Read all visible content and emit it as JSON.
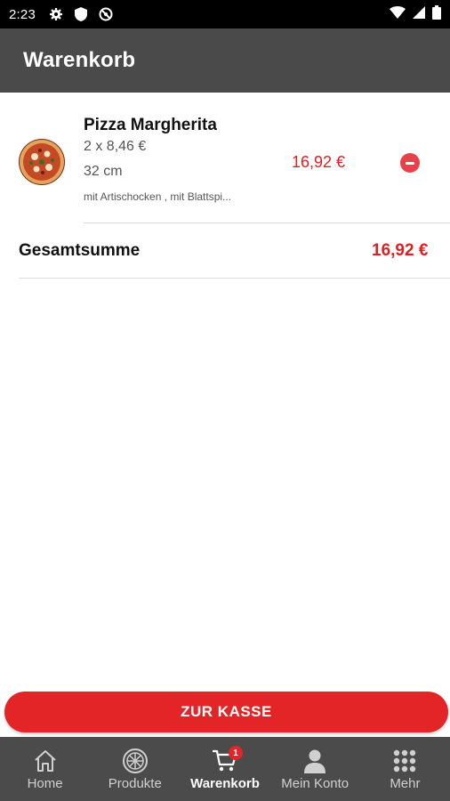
{
  "status_bar": {
    "time": "2:23",
    "icons": [
      "gear-icon",
      "shield-icon",
      "no-disturb-icon",
      "wifi-icon",
      "signal-icon",
      "battery-icon"
    ]
  },
  "app_bar": {
    "title": "Warenkorb"
  },
  "cart": {
    "items": [
      {
        "name": "Pizza Margherita",
        "quantity_price": "2 x 8,46 €",
        "size": "32 cm",
        "extras": "mit Artischocken , mit Blattspi...",
        "price": "16,92 €"
      }
    ],
    "total_label": "Gesamtsumme",
    "total_value": "16,92 €"
  },
  "checkout": {
    "label": "ZUR KASSE"
  },
  "bottom_nav": {
    "items": [
      {
        "label": "Home",
        "icon": "home-icon"
      },
      {
        "label": "Produkte",
        "icon": "pizza-icon"
      },
      {
        "label": "Warenkorb",
        "icon": "cart-icon",
        "badge": "1",
        "active": true
      },
      {
        "label": "Mein Konto",
        "icon": "person-icon"
      },
      {
        "label": "Mehr",
        "icon": "grid-icon"
      }
    ]
  },
  "colors": {
    "accent": "#e42527",
    "price": "#e02020",
    "app_bar": "#4a4a4a",
    "nav_bar": "#4b4b4b"
  }
}
